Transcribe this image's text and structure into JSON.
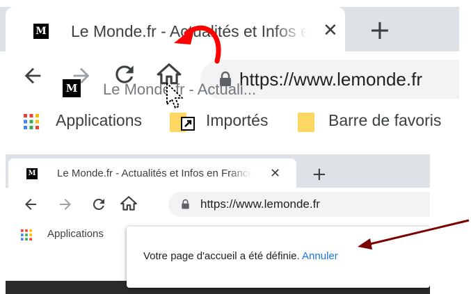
{
  "colors": {
    "tabstrip": "#dee1e6",
    "omnibox": "#f1f3f4",
    "annotation_red": "#ff0000",
    "annotation_arrow": "#7b0000",
    "link": "#1a73e8"
  },
  "top_panel": {
    "tab": {
      "favicon_letter": "M",
      "title": "Le Monde.fr - Actualités et Infos en France et dans le monde",
      "close_glyph": "✕"
    },
    "new_tab_glyph": "+",
    "address": {
      "url": "https://www.lemonde.fr"
    },
    "drag_ghost": {
      "favicon_letter": "M",
      "title": "Le Monde.fr - Actuali..."
    },
    "bookmarks": [
      {
        "label": "Applications",
        "icon": "apps-grid-icon"
      },
      {
        "label": "Importés",
        "icon": "folder-icon"
      },
      {
        "label": "Barre de favoris",
        "icon": "folder-icon"
      }
    ]
  },
  "bottom_panel": {
    "tab": {
      "favicon_letter": "M",
      "title": "Le Monde.fr - Actualités et Infos en France et dans le monde",
      "close_glyph": "✕"
    },
    "new_tab_glyph": "+",
    "address": {
      "url": "https://www.lemonde.fr"
    },
    "bookmarks": [
      {
        "label": "Applications",
        "icon": "apps-grid-icon"
      }
    ],
    "truncated_letter": "E",
    "notification": {
      "message": "Votre page d'accueil a été définie.",
      "undo_label": "Annuler"
    }
  }
}
